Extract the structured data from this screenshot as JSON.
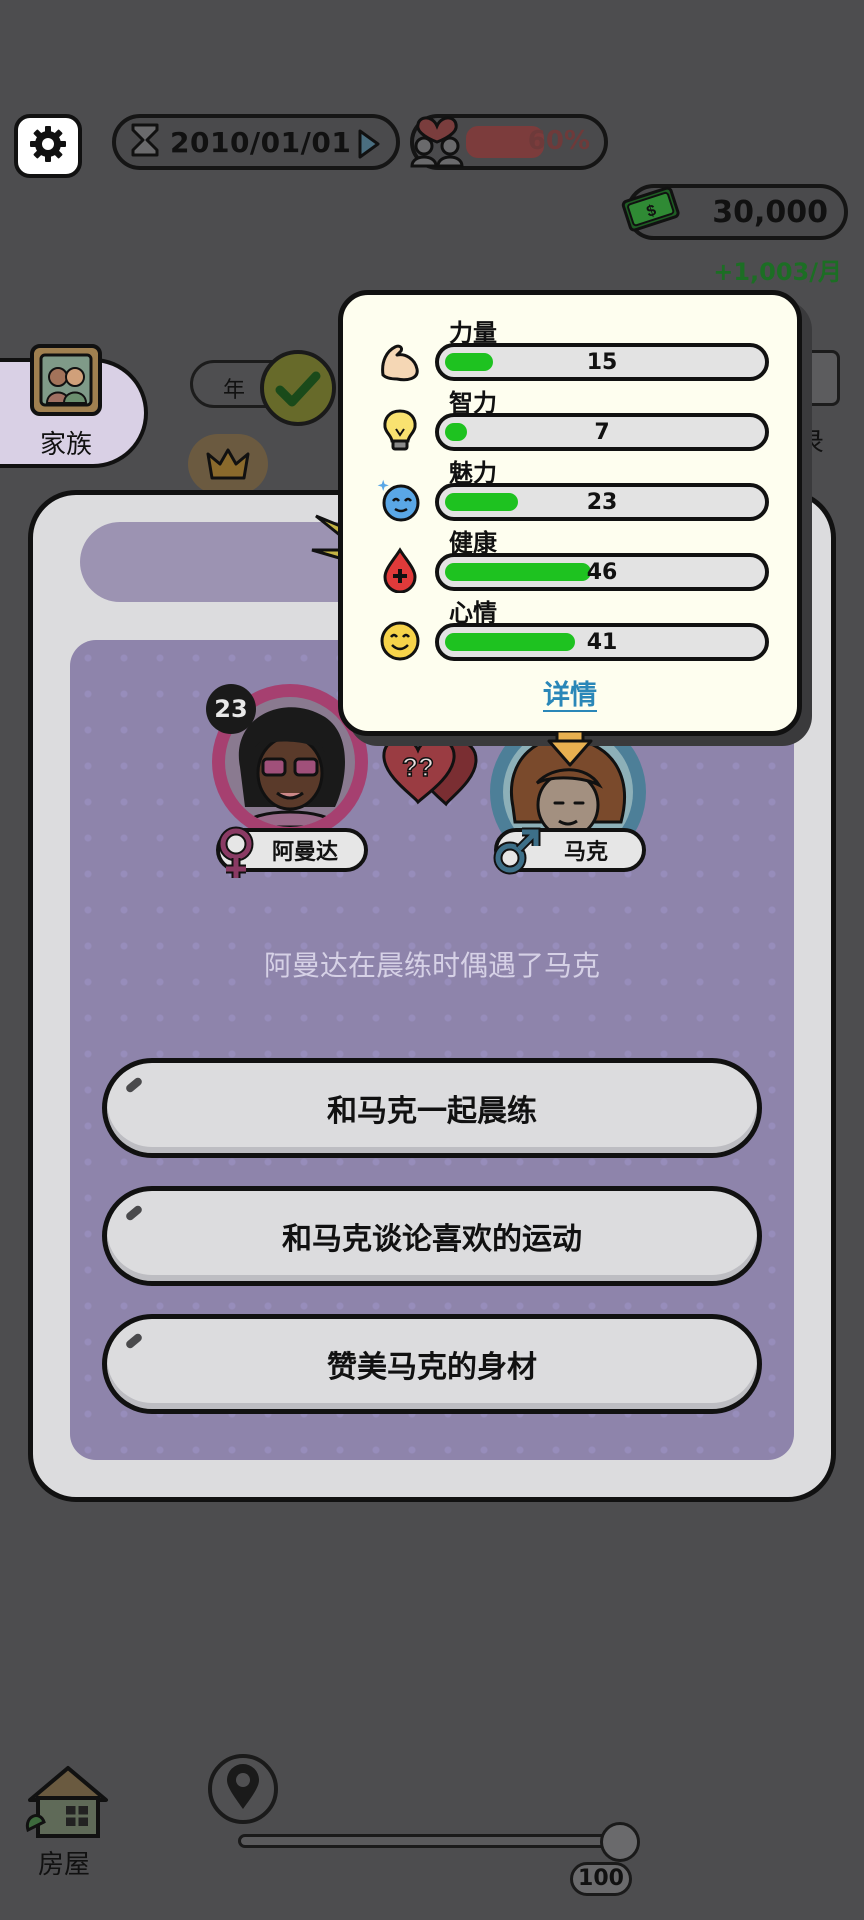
{
  "top_bar": {
    "settings_icon": "gear-icon",
    "date": "2010/01/01",
    "date_icon": "hourglass-icon",
    "advance_icon": "play-icon",
    "relationship_icon": "family-heart-icon",
    "relationship_percent": "60%",
    "relationship_level": 0.6,
    "money": "30,000",
    "money_icon": "cash-icon",
    "income": "+1,003/月"
  },
  "side_tabs": {
    "family_label": "家族",
    "year_label": "年",
    "record_label": "录"
  },
  "stats_popup": {
    "stats": [
      {
        "label": "力量",
        "value": "15",
        "icon": "muscle-icon"
      },
      {
        "label": "智力",
        "value": "7",
        "icon": "lightbulb-icon"
      },
      {
        "label": "魅力",
        "value": "23",
        "icon": "sparkle-face-icon"
      },
      {
        "label": "健康",
        "value": "46",
        "icon": "blood-drop-icon"
      },
      {
        "label": "心情",
        "value": "41",
        "icon": "smiley-icon"
      }
    ],
    "detail_link": "详情",
    "colors": {
      "bar_fill": "#1ec220",
      "link": "#2a87b8"
    }
  },
  "event": {
    "player": {
      "name": "阿曼达",
      "age": "23",
      "gender_icon": "female-icon"
    },
    "npc": {
      "name": "马克",
      "gender_icon": "male-icon"
    },
    "relation_icon": "question-hearts-icon",
    "description": "阿曼达在晨练时偶遇了马克",
    "choices": [
      "和马克一起晨练",
      "和马克谈论喜欢的运动",
      "赞美马克的身材"
    ]
  },
  "bottom": {
    "house_label": "房屋",
    "house_icon": "house-icon",
    "location_icon": "map-pin-icon",
    "slider_value": "100"
  }
}
